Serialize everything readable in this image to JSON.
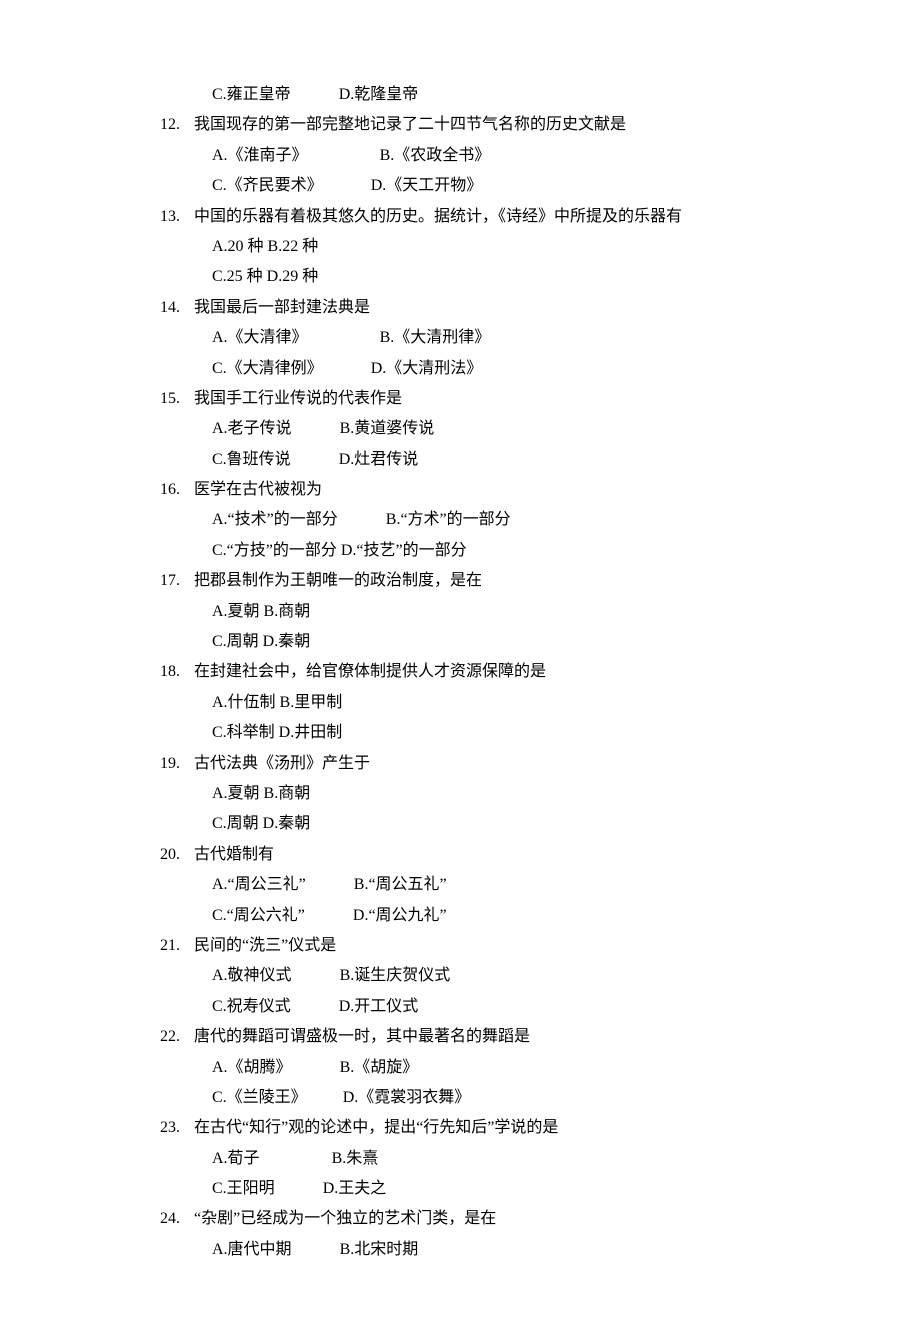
{
  "pre_options": {
    "line1_a": "C.雍正皇帝",
    "line1_b": "D.乾隆皇帝"
  },
  "questions": [
    {
      "n": "12",
      "stem": "我国现存的第一部完整地记录了二十四节气名称的历史文献是",
      "lines": [
        {
          "a": "A.《淮南子》",
          "b": "B.《农政全书》",
          "gap": "gap2"
        },
        {
          "a": "C.《齐民要术》",
          "b": "D.《天工开物》",
          "gap": "gap1"
        }
      ]
    },
    {
      "n": "13",
      "stem": "中国的乐器有着极其悠久的历史。据统计，《诗经》中所提及的乐器有",
      "lines": [
        {
          "a": "A.20 种 B.22 种"
        },
        {
          "a": "C.25 种 D.29 种"
        }
      ]
    },
    {
      "n": "14",
      "stem": "我国最后一部封建法典是",
      "lines": [
        {
          "a": "A.《大清律》",
          "b": "B.《大清刑律》",
          "gap": "gap2"
        },
        {
          "a": "C.《大清律例》",
          "b": "D.《大清刑法》",
          "gap": "gap1"
        }
      ]
    },
    {
      "n": "15",
      "stem": "我国手工行业传说的代表作是",
      "lines": [
        {
          "a": "A.老子传说",
          "b": "B.黄道婆传说",
          "gap": "gap1"
        },
        {
          "a": "C.鲁班传说",
          "b": "D.灶君传说",
          "gap": "gap1"
        }
      ]
    },
    {
      "n": "16",
      "stem": "医学在古代被视为",
      "lines": [
        {
          "a": "A.“技术”的一部分",
          "b": "B.“方术”的一部分",
          "gap": "gap1"
        },
        {
          "a": "C.“方技”的一部分 D.“技艺”的一部分"
        }
      ]
    },
    {
      "n": "17",
      "stem": "把郡县制作为王朝唯一的政治制度，是在",
      "lines": [
        {
          "a": "A.夏朝 B.商朝"
        },
        {
          "a": "C.周朝 D.秦朝"
        }
      ]
    },
    {
      "n": "18",
      "stem": "在封建社会中，给官僚体制提供人才资源保障的是",
      "lines": [
        {
          "a": "A.什伍制 B.里甲制"
        },
        {
          "a": "C.科举制 D.井田制"
        }
      ]
    },
    {
      "n": "19",
      "stem": "古代法典《汤刑》产生于",
      "lines": [
        {
          "a": "A.夏朝 B.商朝"
        },
        {
          "a": "C.周朝 D.秦朝"
        }
      ]
    },
    {
      "n": "20",
      "stem": "古代婚制有",
      "lines": [
        {
          "a": "A.“周公三礼”",
          "b": "B.“周公五礼”",
          "gap": "gap1"
        },
        {
          "a": "C.“周公六礼”",
          "b": "D.“周公九礼”",
          "gap": "gap1"
        }
      ]
    },
    {
      "n": "21",
      "stem": "民间的“洗三”仪式是",
      "lines": [
        {
          "a": "A.敬神仪式",
          "b": "B.诞生庆贺仪式",
          "gap": "gap1"
        },
        {
          "a": "C.祝寿仪式",
          "b": "D.开工仪式",
          "gap": "gap1"
        }
      ]
    },
    {
      "n": "22",
      "stem": "唐代的舞蹈可谓盛极一时，其中最著名的舞蹈是",
      "lines": [
        {
          "a": "A.《胡腾》",
          "b": "B.《胡旋》",
          "gap": "gap1"
        },
        {
          "a": "C.《兰陵王》",
          "b": "D.《霓裳羽衣舞》",
          "gap": "gap3"
        }
      ]
    },
    {
      "n": "23",
      "stem": "在古代“知行”观的论述中，提出“行先知后”学说的是",
      "lines": [
        {
          "a": "A.荀子",
          "b": "B.朱熹",
          "gap": "gap2"
        },
        {
          "a": "C.王阳明",
          "b": "D.王夫之",
          "gap": "gap1"
        }
      ]
    },
    {
      "n": "24",
      "stem": "“杂剧”已经成为一个独立的艺术门类，是在",
      "lines": [
        {
          "a": "A.唐代中期",
          "b": "B.北宋时期",
          "gap": "gap1"
        }
      ]
    }
  ]
}
